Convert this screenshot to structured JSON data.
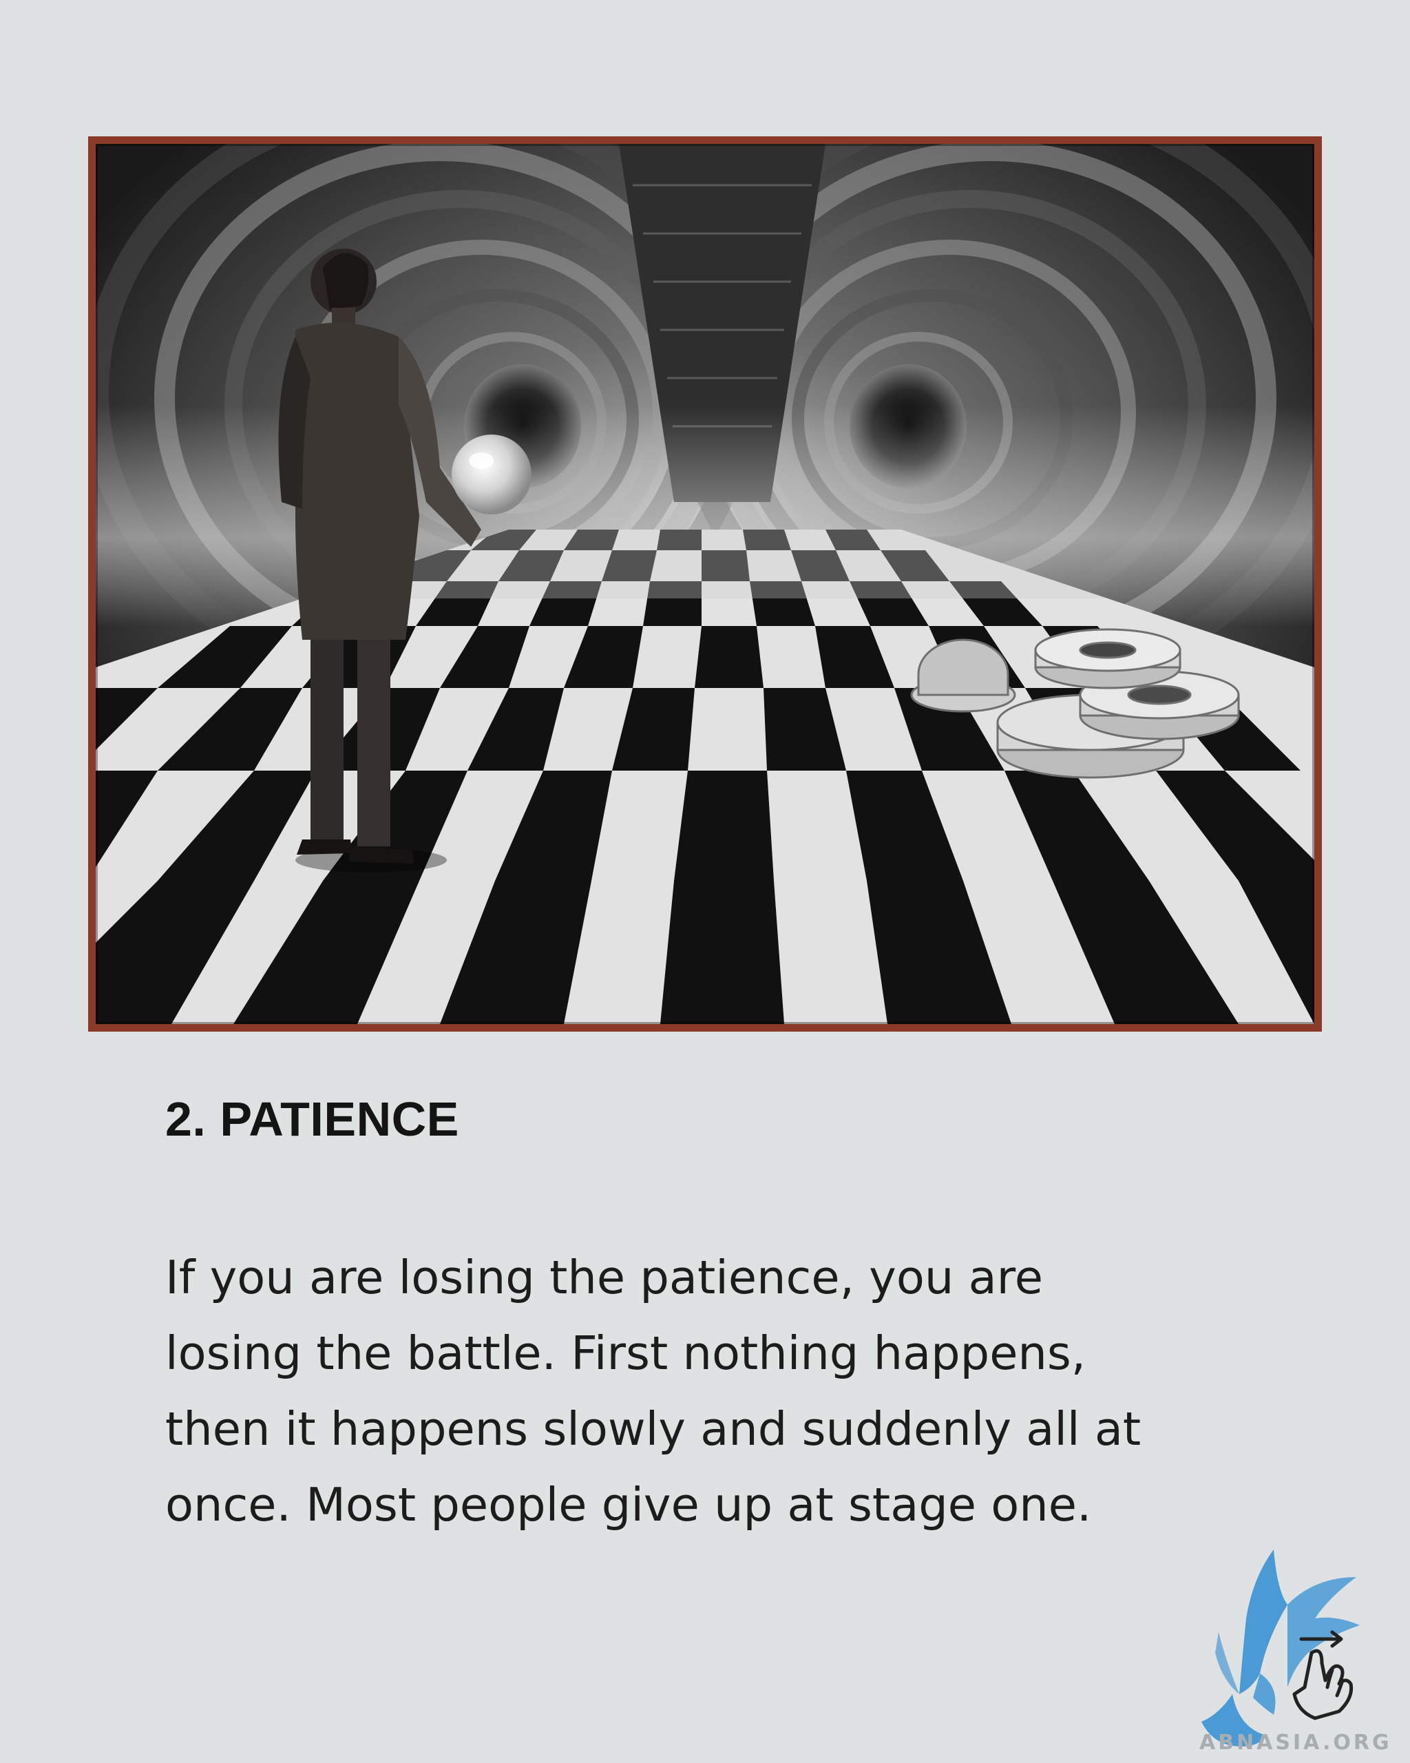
{
  "card": {
    "heading": "2. PATIENCE",
    "body_lines": [
      "If you are losing the patience, you are",
      "losing the battle. First nothing happens,",
      "then it happens slowly and suddenly all at",
      "once. Most people give up at stage one."
    ]
  },
  "artwork": {
    "subject": "man holding glowing orb on checkered floor in swirling tunnel",
    "frame_color": "#8a3a26"
  },
  "branding": {
    "site_name": "ABNASIA.ORG",
    "logo_icon": "eagle-icon",
    "swipe_icon": "swipe-hand-icon",
    "logo_color": "#4a9ad6"
  }
}
